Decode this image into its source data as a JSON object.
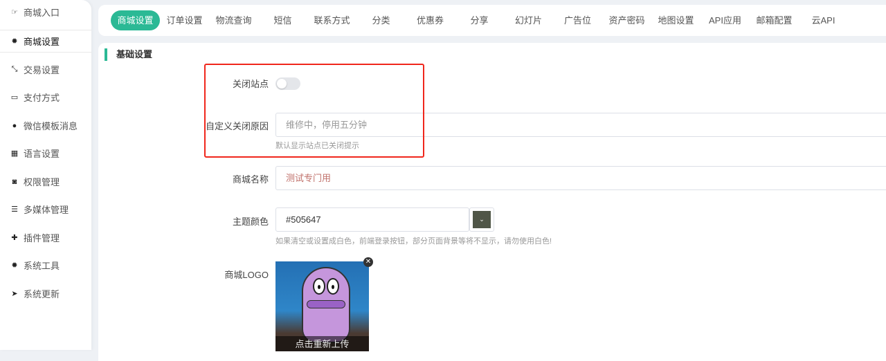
{
  "sidebar": {
    "items": [
      {
        "label": "商城入口",
        "icon": "hand-point-icon"
      },
      {
        "label": "商城设置",
        "icon": "gear-icon"
      },
      {
        "label": "交易设置",
        "icon": "compress-icon"
      },
      {
        "label": "支付方式",
        "icon": "credit-card-icon"
      },
      {
        "label": "微信模板消息",
        "icon": "wechat-icon"
      },
      {
        "label": "语言设置",
        "icon": "language-icon"
      },
      {
        "label": "权限管理",
        "icon": "gamepad-icon"
      },
      {
        "label": "多媒体管理",
        "icon": "list-icon"
      },
      {
        "label": "插件管理",
        "icon": "puzzle-icon"
      },
      {
        "label": "系统工具",
        "icon": "gear-icon"
      },
      {
        "label": "系统更新",
        "icon": "paper-plane-icon"
      }
    ]
  },
  "tabs": [
    "商城设置",
    "订单设置",
    "物流查询",
    "短信",
    "联系方式",
    "分类",
    "优惠券",
    "分享",
    "幻灯片",
    "广告位",
    "资产密码",
    "地图设置",
    "API应用",
    "邮箱配置",
    "云API"
  ],
  "section_title": "基础设置",
  "form": {
    "close_site": {
      "label": "关闭站点",
      "value": false
    },
    "close_reason": {
      "label": "自定义关闭原因",
      "placeholder": "维修中，停用五分钟",
      "help": "默认显示站点已关闭提示"
    },
    "shop_name": {
      "label": "商城名称",
      "value": "测试专门用"
    },
    "theme_color": {
      "label": "主题颜色",
      "value": "#505647",
      "help": "如果清空或设置成白色，前端登录按钮，部分页面背景等将不显示，请勿使用白色!"
    },
    "logo": {
      "label": "商城LOGO",
      "reupload": "点击重新上传"
    }
  },
  "colors": {
    "accent": "#2bb995",
    "theme": "#505647",
    "highlight": "#f0261b"
  }
}
